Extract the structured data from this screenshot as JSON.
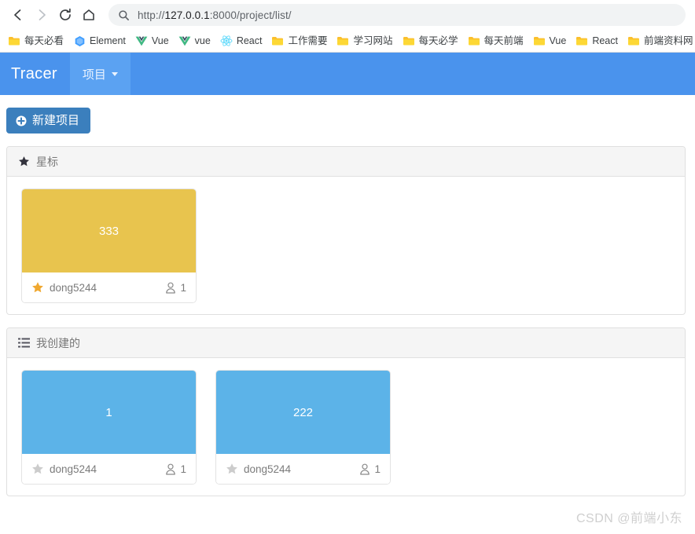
{
  "browser": {
    "nav": {
      "back": "back-arrow",
      "forward": "forward-arrow",
      "reload": "reload",
      "home": "home"
    },
    "omnibox": {
      "icon": "search-icon",
      "url_scheme": "http://",
      "url_host": "127.0.0.1",
      "url_rest": ":8000/project/list/",
      "full_url": "http://127.0.0.1:8000/project/list/"
    },
    "bookmarks": [
      {
        "label": "每天必看",
        "icon": "folder-icon"
      },
      {
        "label": "Element",
        "icon": "element-logo-icon"
      },
      {
        "label": "Vue",
        "icon": "vue-logo-icon"
      },
      {
        "label": "vue",
        "icon": "vue-logo-icon"
      },
      {
        "label": "React",
        "icon": "react-logo-icon"
      },
      {
        "label": "工作需要",
        "icon": "folder-icon"
      },
      {
        "label": "学习网站",
        "icon": "folder-icon"
      },
      {
        "label": "每天必学",
        "icon": "folder-icon"
      },
      {
        "label": "每天前端",
        "icon": "folder-icon"
      },
      {
        "label": "Vue",
        "icon": "folder-icon"
      },
      {
        "label": "React",
        "icon": "folder-icon"
      },
      {
        "label": "前端资料网",
        "icon": "folder-icon"
      },
      {
        "label": "",
        "icon": "folder-icon"
      }
    ]
  },
  "app": {
    "brand": "Tracer",
    "nav_tabs": [
      {
        "label": "项目",
        "has_caret": true,
        "active": true
      }
    ],
    "toolbar": {
      "new_project_label": "新建项目",
      "new_project_icon": "plus-circle-icon"
    },
    "sections": [
      {
        "id": "starred",
        "icon": "star-icon",
        "title": "星标",
        "cards": [
          {
            "name": "333",
            "cover_color": "#e8c44e",
            "starred": true,
            "owner": "dong5244",
            "member_count": "1",
            "member_icon": "person-icon"
          }
        ]
      },
      {
        "id": "created-by-me",
        "icon": "list-icon",
        "title": "我创建的",
        "cards": [
          {
            "name": "1",
            "cover_color": "#5cb3e8",
            "starred": false,
            "owner": "dong5244",
            "member_count": "1",
            "member_icon": "person-icon"
          },
          {
            "name": "222",
            "cover_color": "#5cb3e8",
            "starred": false,
            "owner": "dong5244",
            "member_count": "1",
            "member_icon": "person-icon"
          }
        ]
      }
    ]
  },
  "watermark": "CSDN @前端小东",
  "colors": {
    "nav_bar": "#4a93ed",
    "nav_tab_active": "#5ba2f2",
    "primary_button": "#3b7fbd",
    "card_yellow": "#e8c44e",
    "card_blue": "#5cb3e8",
    "star_active": "#f0a830",
    "star_inactive": "#cccccc"
  }
}
